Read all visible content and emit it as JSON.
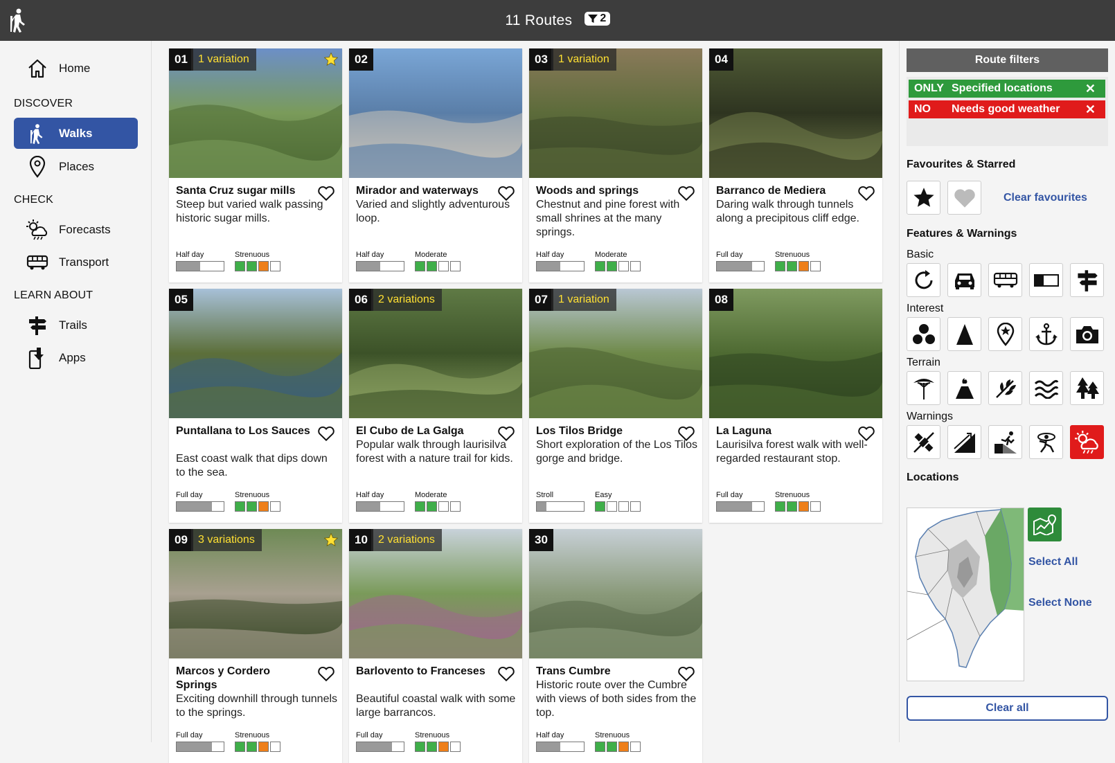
{
  "header": {
    "logo_icon": "hiker-icon",
    "route_count": "11 Routes",
    "filter_icon": "filter-icon",
    "filter_count": "2"
  },
  "sidebar": {
    "home": {
      "label": "Home",
      "icon": "home-icon"
    },
    "discover_title": "DISCOVER",
    "walks": {
      "label": "Walks",
      "icon": "hiker-icon"
    },
    "places": {
      "label": "Places",
      "icon": "map-pin-icon"
    },
    "check_title": "CHECK",
    "forecasts": {
      "label": "Forecasts",
      "icon": "weather-icon"
    },
    "transport": {
      "label": "Transport",
      "icon": "bus-icon"
    },
    "learn_title": "LEARN ABOUT",
    "trails": {
      "label": "Trails",
      "icon": "signpost-icon"
    },
    "apps": {
      "label": "Apps",
      "icon": "phone-download-icon"
    }
  },
  "routes": [
    {
      "num": "01",
      "variations": "1 variation",
      "starred": true,
      "title": "Santa Cruz sugar mills",
      "desc": "Steep but varied walk passing historic sugar mills.",
      "duration_label": "Half day",
      "duration_level": 0.5,
      "difficulty_label": "Strenuous",
      "difficulty_level": 3
    },
    {
      "num": "02",
      "variations": "",
      "starred": false,
      "title": "Mirador and waterways",
      "desc": "Varied and slightly adventurous loop.",
      "duration_label": "Half day",
      "duration_level": 0.5,
      "difficulty_label": "Moderate",
      "difficulty_level": 2
    },
    {
      "num": "03",
      "variations": "1 variation",
      "starred": false,
      "title": "Woods and springs",
      "desc": "Chestnut and pine forest with small shrines at the many springs.",
      "duration_label": "Half day",
      "duration_level": 0.5,
      "difficulty_label": "Moderate",
      "difficulty_level": 2
    },
    {
      "num": "04",
      "variations": "",
      "starred": false,
      "title": "Barranco de Mediera",
      "desc": "Daring walk through tunnels along a precipitous cliff edge.",
      "duration_label": "Full day",
      "duration_level": 0.75,
      "difficulty_label": "Strenuous",
      "difficulty_level": 3
    },
    {
      "num": "05",
      "variations": "",
      "starred": false,
      "title": "Puntallana to Los Sauces",
      "desc": "East coast walk that dips down to the sea.",
      "duration_label": "Full day",
      "duration_level": 0.75,
      "difficulty_label": "Strenuous",
      "difficulty_level": 3
    },
    {
      "num": "06",
      "variations": "2 variations",
      "starred": false,
      "title": "El Cubo de La Galga",
      "desc": "Popular walk through laurisilva forest with a nature trail for kids.",
      "duration_label": "Half day",
      "duration_level": 0.5,
      "difficulty_label": "Moderate",
      "difficulty_level": 2
    },
    {
      "num": "07",
      "variations": "1 variation",
      "starred": false,
      "title": "Los Tilos Bridge",
      "desc": "Short exploration of the Los Tilos gorge and bridge.",
      "duration_label": "Stroll",
      "duration_level": 0.2,
      "difficulty_label": "Easy",
      "difficulty_level": 1
    },
    {
      "num": "08",
      "variations": "",
      "starred": false,
      "title": "La Laguna",
      "desc": "Laurisilva forest walk with well-regarded restaurant stop.",
      "duration_label": "Full day",
      "duration_level": 0.75,
      "difficulty_label": "Strenuous",
      "difficulty_level": 3
    },
    {
      "num": "09",
      "variations": "3 variations",
      "starred": true,
      "title": "Marcos y Cordero Springs",
      "desc": "Exciting downhill through tunnels to the springs.",
      "duration_label": "Full day",
      "duration_level": 0.75,
      "difficulty_label": "Strenuous",
      "difficulty_level": 3
    },
    {
      "num": "10",
      "variations": "2 variations",
      "starred": false,
      "title": "Barlovento to Franceses",
      "desc": "Beautiful coastal walk with some large barrancos.",
      "duration_label": "Full day",
      "duration_level": 0.75,
      "difficulty_label": "Strenuous",
      "difficulty_level": 3
    },
    {
      "num": "30",
      "variations": "",
      "starred": false,
      "title": "Trans Cumbre",
      "desc": "Historic route over the Cumbre with views of both sides from the top.",
      "duration_label": "Half day",
      "duration_level": 0.5,
      "difficulty_label": "Strenuous",
      "difficulty_level": 3
    }
  ],
  "filters": {
    "title": "Route filters",
    "active": [
      {
        "mode": "ONLY",
        "label": "Specified locations",
        "color": "#2e9a3c"
      },
      {
        "mode": "NO",
        "label": "Needs good weather",
        "color": "#e01b1b"
      }
    ],
    "fav_title": "Favourites & Starred",
    "clear_favourites": "Clear favourites",
    "features_title": "Features & Warnings",
    "basic_title": "Basic",
    "basic_icons": [
      "loop-icon",
      "car-icon",
      "bus-icon",
      "half-toggle-icon",
      "signpost-icon"
    ],
    "interest_title": "Interest",
    "interest_icons": [
      "circles-icon",
      "peak-icon",
      "map-pin-star-icon",
      "anchor-icon",
      "camera-icon"
    ],
    "terrain_title": "Terrain",
    "terrain_icons": [
      "dragon-tree-icon",
      "volcano-icon",
      "leaf-icon",
      "waves-icon",
      "pine-trees-icon"
    ],
    "warnings_title": "Warnings",
    "warnings_icons": [
      "satellite-icon",
      "steep-slope-icon",
      "fall-hazard-icon",
      "vertigo-icon",
      "weather-warning-icon"
    ],
    "locations_title": "Locations",
    "select_all": "Select All",
    "select_none": "Select None",
    "clear_all": "Clear all"
  },
  "colors": {
    "accent": "#3355a4",
    "easy_green": "#3fae49",
    "strenuous_orange": "#ee7f1a",
    "topbar": "#3d3d3d"
  }
}
